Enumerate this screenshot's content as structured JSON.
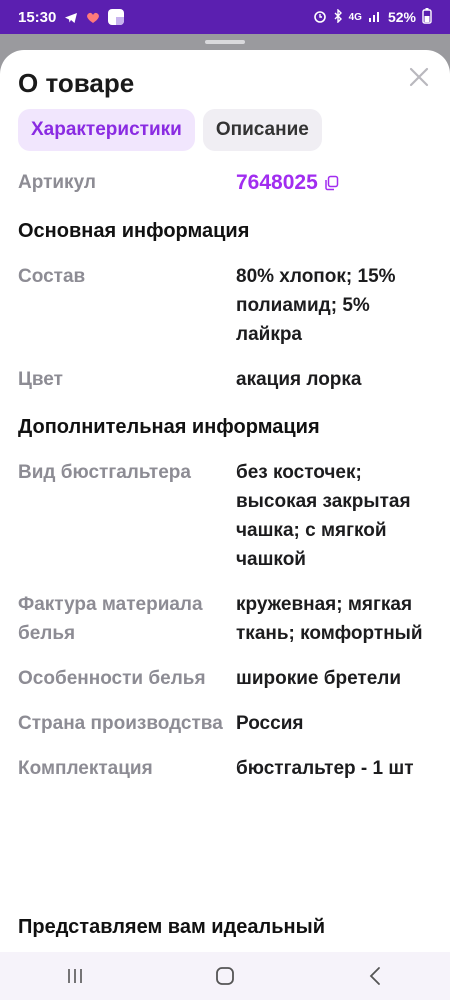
{
  "status_bar": {
    "time": "15:30",
    "network": "4G",
    "battery": "52%"
  },
  "sheet": {
    "title": "О товаре",
    "tabs": [
      {
        "label": "Характеристики",
        "active": true
      },
      {
        "label": "Описание",
        "active": false
      }
    ],
    "article": {
      "label": "Артикул",
      "value": "7648025"
    },
    "sections": [
      {
        "title": "Основная информация",
        "rows": [
          {
            "label": "Состав",
            "value": "80% хлопок; 15% полиамид; 5% лайкра"
          },
          {
            "label": "Цвет",
            "value": "акация лорка"
          }
        ]
      },
      {
        "title": "Дополнительная информация",
        "rows": [
          {
            "label": "Вид бюстгальтера",
            "value": "без косточек; высокая закрытая чашка; с мягкой чашкой"
          },
          {
            "label": "Фактура материала белья",
            "value": "кружевная; мягкая ткань; комфортный"
          },
          {
            "label": "Особенности белья",
            "value": "широкие бретели"
          },
          {
            "label": "Страна производства",
            "value": "Россия"
          },
          {
            "label": "Комплектация",
            "value": "бюстгальтер - 1 шт"
          }
        ]
      }
    ],
    "description_preview": "Представляем вам идеальный"
  },
  "colors": {
    "accent": "#a12df0",
    "tab_active_bg": "#f1e6fd",
    "status_bar": "#5b1fb0"
  },
  "icons": {
    "close": "close-icon",
    "copy": "copy-icon",
    "nav_recents": "recents-icon",
    "nav_home": "home-icon",
    "nav_back": "back-icon"
  }
}
